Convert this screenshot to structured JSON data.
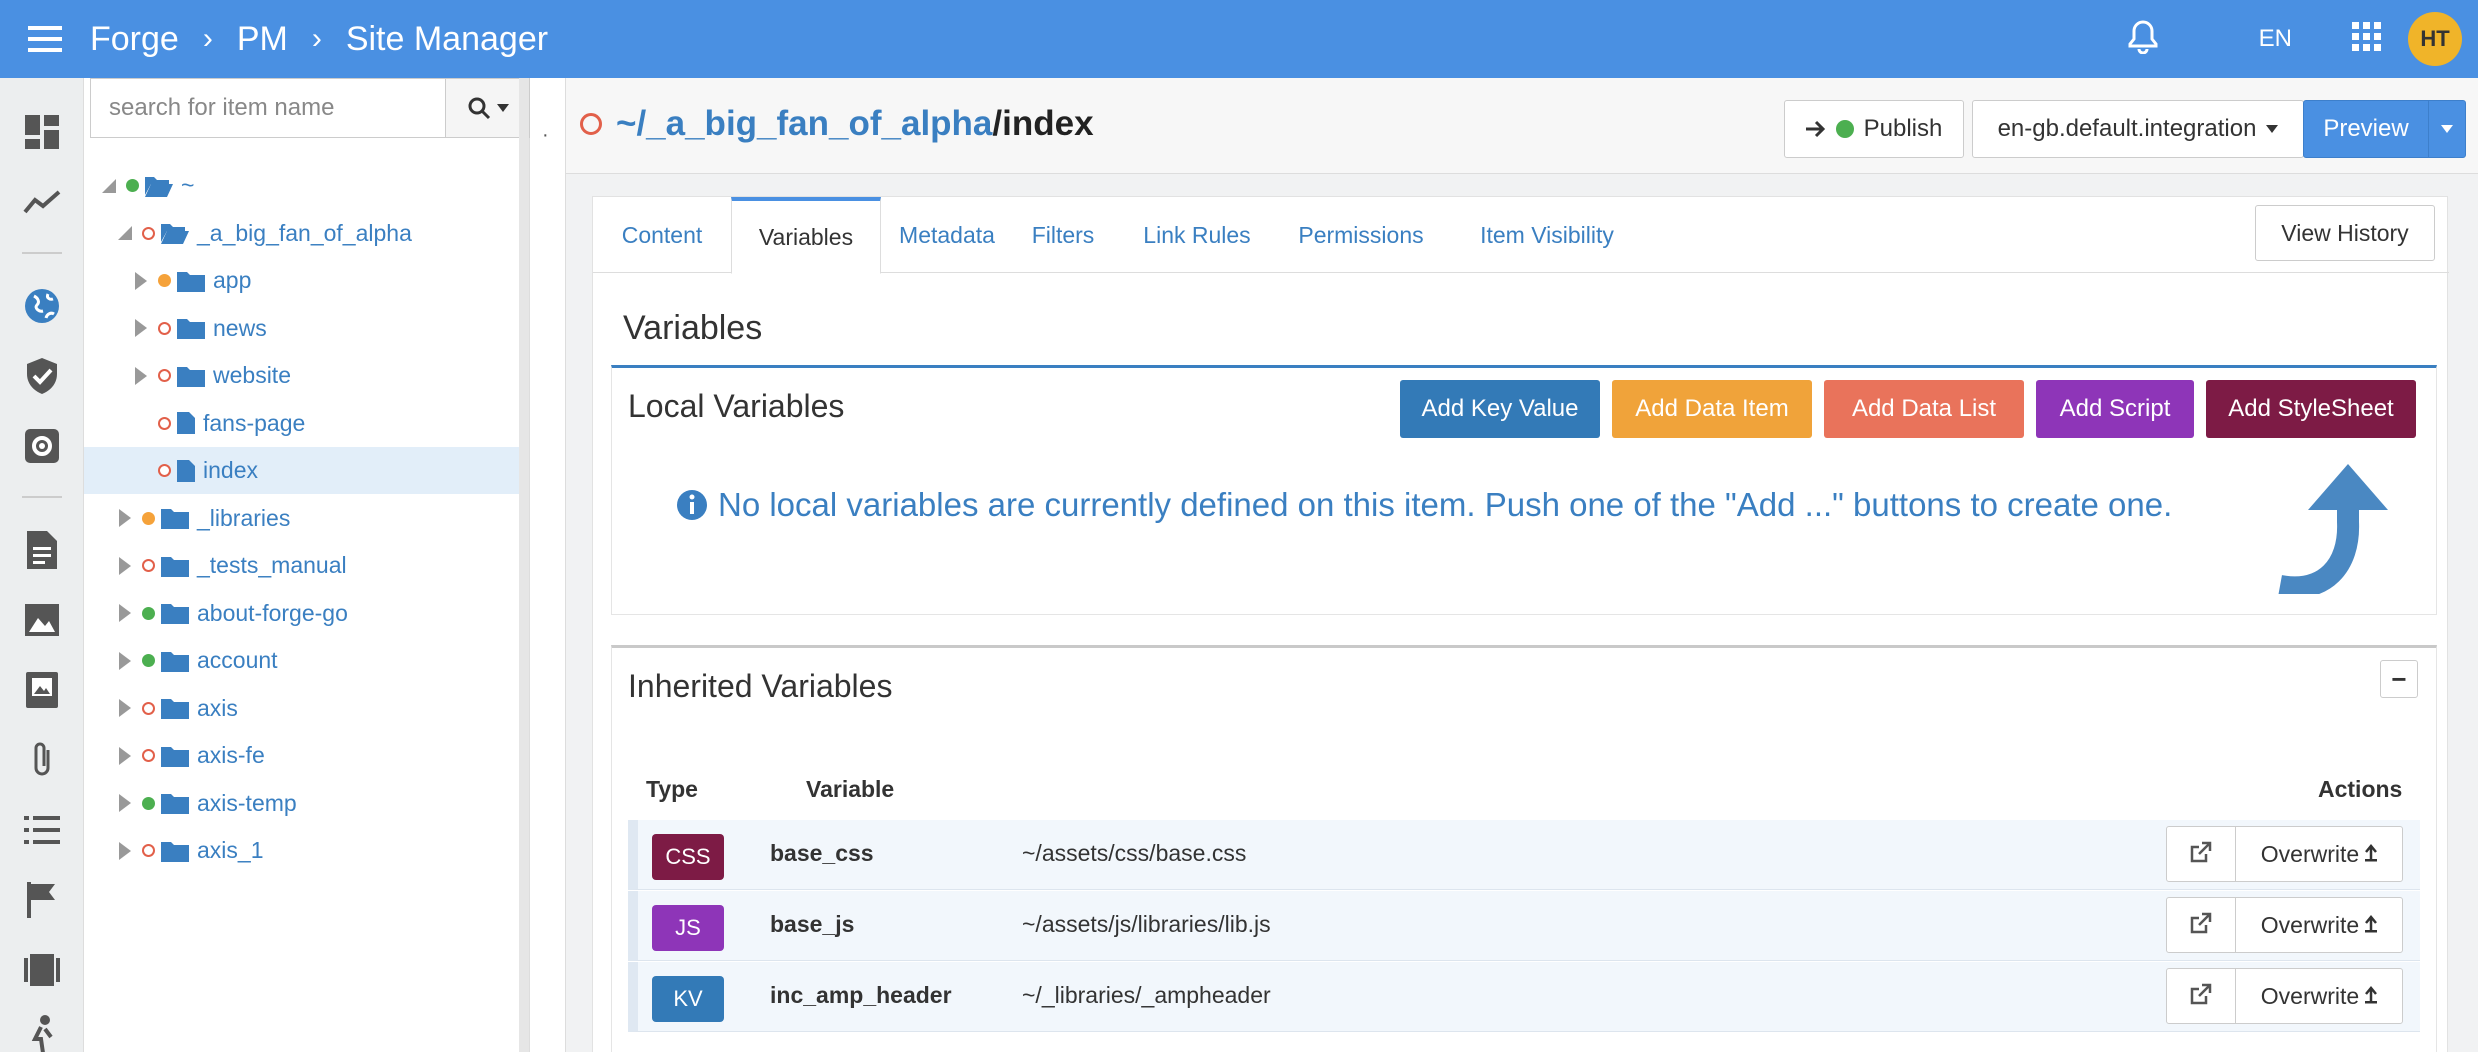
{
  "header": {
    "breadcrumbs": [
      "Forge",
      "PM",
      "Site Manager"
    ],
    "language": "EN",
    "avatar_initials": "HT",
    "color": "#4a90e2"
  },
  "sidebar": {
    "icons": [
      "dashboard-icon",
      "analytics-icon",
      "globe-icon",
      "shield-icon",
      "settings-icon",
      "document-icon",
      "image-icon",
      "photo-book-icon",
      "paperclip-icon",
      "list-icon",
      "flag-icon",
      "film-icon",
      "user-walk-icon"
    ]
  },
  "tree": {
    "search_placeholder": "search for item name",
    "items": [
      {
        "label": "~",
        "status": "green",
        "type": "folder-open",
        "level": 0,
        "expanded": true
      },
      {
        "label": "_a_big_fan_of_alpha",
        "status": "empty",
        "type": "folder-open",
        "level": 1,
        "expanded": true
      },
      {
        "label": "app",
        "status": "orange",
        "type": "folder",
        "level": 2
      },
      {
        "label": "news",
        "status": "empty",
        "type": "folder",
        "level": 2
      },
      {
        "label": "website",
        "status": "empty",
        "type": "folder",
        "level": 2
      },
      {
        "label": "fans-page",
        "status": "empty",
        "type": "file",
        "level": 2
      },
      {
        "label": "index",
        "status": "empty",
        "type": "file",
        "level": 2,
        "selected": true
      },
      {
        "label": "_libraries",
        "status": "orange",
        "type": "folder",
        "level": 1
      },
      {
        "label": "_tests_manual",
        "status": "empty",
        "type": "folder",
        "level": 1
      },
      {
        "label": "about-forge-go",
        "status": "green",
        "type": "folder",
        "level": 1
      },
      {
        "label": "account",
        "status": "green",
        "type": "folder",
        "level": 1
      },
      {
        "label": "axis",
        "status": "empty",
        "type": "folder",
        "level": 1
      },
      {
        "label": "axis-fe",
        "status": "empty",
        "type": "folder",
        "level": 1
      },
      {
        "label": "axis-temp",
        "status": "green",
        "type": "folder",
        "level": 1
      },
      {
        "label": "axis_1",
        "status": "empty",
        "type": "folder",
        "level": 1
      }
    ]
  },
  "page": {
    "path_link": "~/_a_big_fan_of_alpha",
    "path_end": "/index",
    "publish_label": "Publish",
    "context_label": "en-gb.default.integration",
    "preview_label": "Preview",
    "view_history_label": "View History"
  },
  "tabs": [
    "Content",
    "Variables",
    "Metadata",
    "Filters",
    "Link Rules",
    "Permissions",
    "Item Visibility"
  ],
  "active_tab": "Variables",
  "variables": {
    "section_title": "Variables",
    "local": {
      "title": "Local Variables",
      "buttons": [
        {
          "label": "Add Key Value",
          "color": "#337ab7"
        },
        {
          "label": "Add Data Item",
          "color": "#f0a33a"
        },
        {
          "label": "Add Data List",
          "color": "#e9735b"
        },
        {
          "label": "Add Script",
          "color": "#8e35b8"
        },
        {
          "label": "Add StyleSheet",
          "color": "#7d1b45"
        }
      ],
      "empty_message": "No local variables are currently defined on this item. Push one of the \"Add ...\" buttons to create one."
    },
    "inherited": {
      "title": "Inherited Variables",
      "collapse_symbol": "−",
      "columns": {
        "type": "Type",
        "variable": "Variable",
        "actions": "Actions"
      },
      "overwrite_label": "Overwrite",
      "rows": [
        {
          "type": "CSS",
          "color": "#7d1b45",
          "name": "base_css",
          "value": "~/assets/css/base.css"
        },
        {
          "type": "JS",
          "color": "#8e35b8",
          "name": "base_js",
          "value": "~/assets/js/libraries/lib.js"
        },
        {
          "type": "KV",
          "color": "#337ab7",
          "name": "inc_amp_header",
          "value": "~/_libraries/_ampheader"
        }
      ]
    }
  }
}
